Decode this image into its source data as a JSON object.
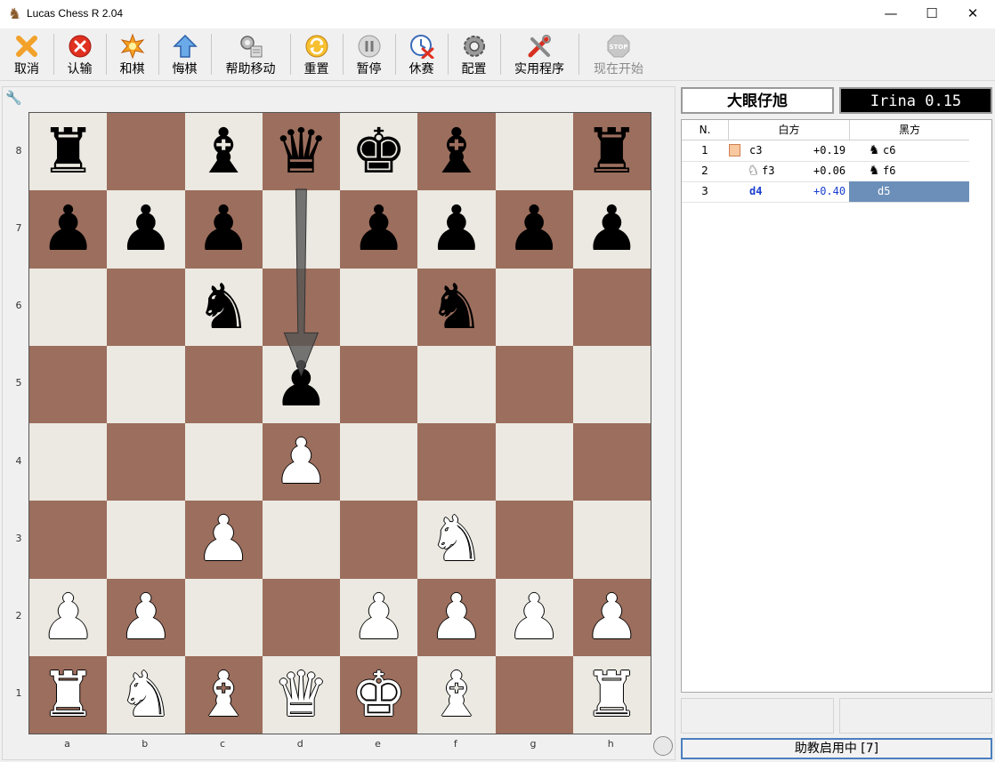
{
  "window": {
    "title": "Lucas Chess R 2.04",
    "minimize": "—",
    "maximize": "☐",
    "close": "✕"
  },
  "toolbar": [
    {
      "label": "取消",
      "icon": "cancel-icon",
      "enabled": true
    },
    {
      "label": "认输",
      "icon": "resign-icon",
      "enabled": true
    },
    {
      "label": "和棋",
      "icon": "draw-icon",
      "enabled": true
    },
    {
      "label": "悔棋",
      "icon": "takeback-icon",
      "enabled": true
    },
    {
      "label": "帮助移动",
      "icon": "help-move-icon",
      "enabled": true
    },
    {
      "label": "重置",
      "icon": "reinit-icon",
      "enabled": true
    },
    {
      "label": "暂停",
      "icon": "pause-icon",
      "enabled": true
    },
    {
      "label": "休赛",
      "icon": "adjourn-icon",
      "enabled": true
    },
    {
      "label": "配置",
      "icon": "config-icon",
      "enabled": true
    },
    {
      "label": "实用程序",
      "icon": "utilities-icon",
      "enabled": true
    },
    {
      "label": "现在开始",
      "icon": "stop-icon",
      "enabled": false
    }
  ],
  "board": {
    "files": [
      "a",
      "b",
      "c",
      "d",
      "e",
      "f",
      "g",
      "h"
    ],
    "ranks": [
      "8",
      "7",
      "6",
      "5",
      "4",
      "3",
      "2",
      "1"
    ],
    "light_color": "#ebe9e1",
    "dark_color": "#9c6e5d",
    "position": [
      [
        "r",
        "",
        "b",
        "q",
        "k",
        "b",
        "",
        "r"
      ],
      [
        "p",
        "p",
        "p",
        "",
        "p",
        "p",
        "p",
        "p"
      ],
      [
        "",
        "",
        "n",
        "",
        "",
        "n",
        "",
        ""
      ],
      [
        "",
        "",
        "",
        "p",
        "",
        "",
        "",
        ""
      ],
      [
        "",
        "",
        "",
        "P",
        "",
        "",
        "",
        ""
      ],
      [
        "",
        "",
        "P",
        "",
        "",
        "N",
        "",
        ""
      ],
      [
        "P",
        "P",
        "",
        "",
        "P",
        "P",
        "P",
        "P"
      ],
      [
        "R",
        "N",
        "B",
        "Q",
        "K",
        "B",
        "",
        "R"
      ]
    ],
    "last_move_arrow": {
      "from": "d7",
      "to": "d5"
    }
  },
  "players": {
    "white": "大眼仔旭",
    "black": "Irina 0.15"
  },
  "moves": {
    "headers": {
      "num": "N.",
      "white": "白方",
      "black": "黑方"
    },
    "rows": [
      {
        "n": "1",
        "white_icon": "square-marker",
        "white": "c3",
        "eval": "+0.19",
        "black_icon": "knight-icon",
        "black": "c6"
      },
      {
        "n": "2",
        "white_icon": "knight-icon",
        "white": "f3",
        "eval": "+0.06",
        "black_icon": "knight-icon",
        "black": "f6"
      },
      {
        "n": "3",
        "white_icon": "",
        "white": "d4",
        "eval": "+0.40",
        "black_icon": "",
        "black": "d5"
      }
    ]
  },
  "status": {
    "tutor": "助教启用中 [7]"
  }
}
